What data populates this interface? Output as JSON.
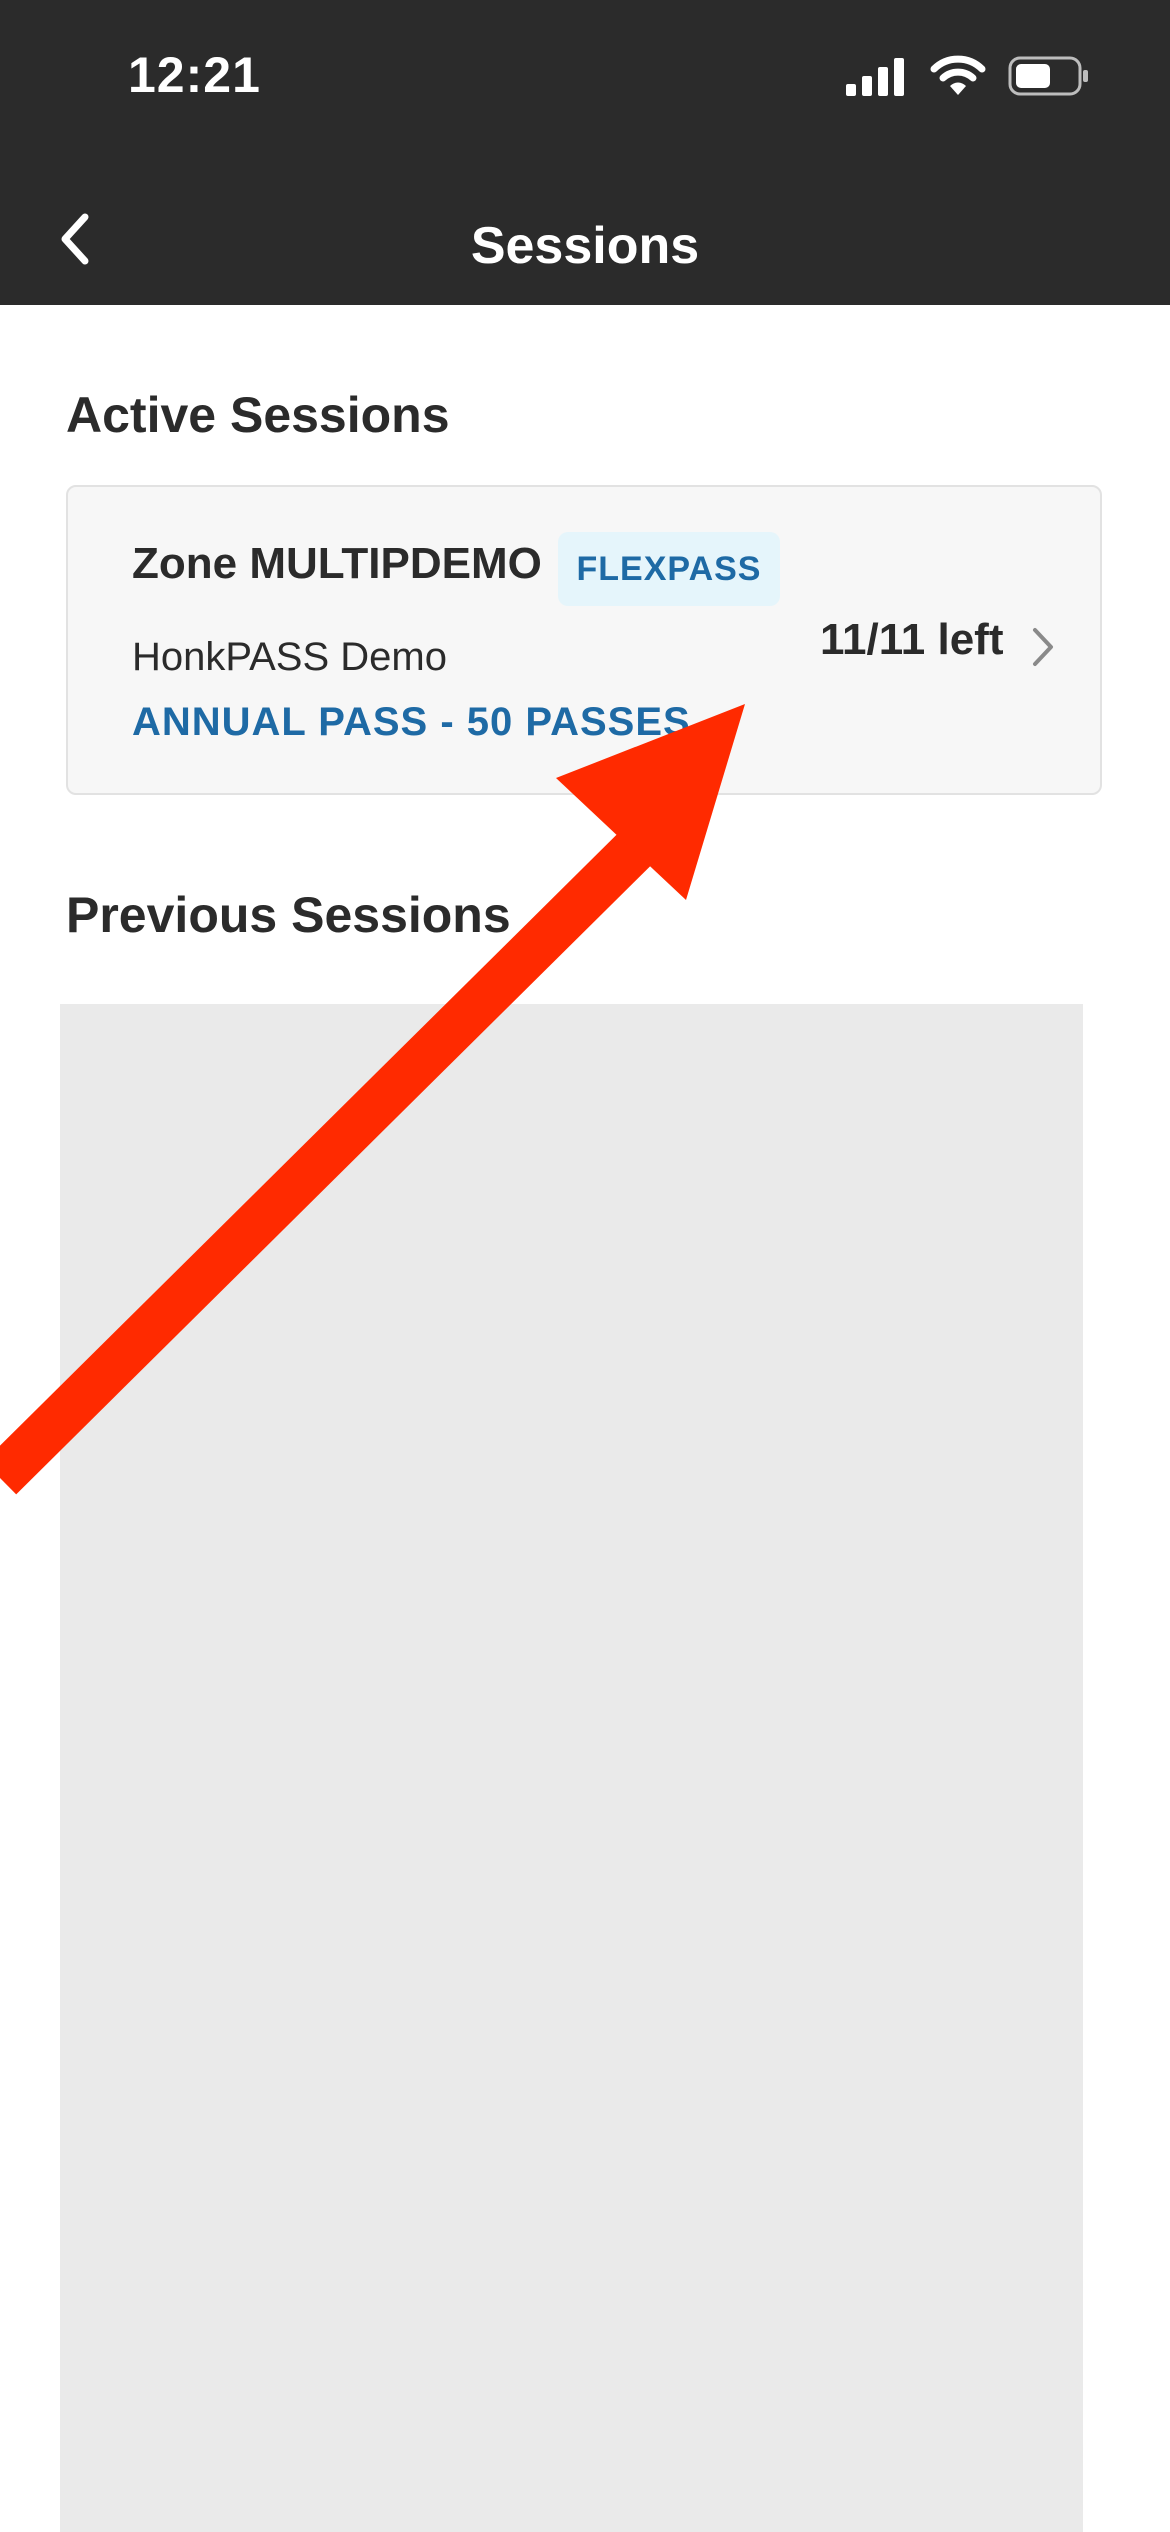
{
  "status_bar": {
    "time": "12:21",
    "icons": [
      "signal-icon",
      "wifi-icon",
      "battery-icon"
    ]
  },
  "nav": {
    "back_icon": "chevron-left-icon",
    "title": "Sessions"
  },
  "active_sessions": {
    "title": "Active Sessions",
    "items": [
      {
        "zone": "Zone MULTIPDEMO",
        "badge": "FLEXPASS",
        "company": "HonkPASS Demo",
        "pass_name": "ANNUAL PASS - 50 PASSES",
        "remaining": "11/11 left",
        "chevron_icon": "chevron-right-icon"
      }
    ]
  },
  "previous_sessions": {
    "title": "Previous Sessions"
  },
  "colors": {
    "header_bg": "#2b2b2b",
    "accent_blue": "#1e6aa5",
    "badge_bg": "#e5f5fb",
    "annotation_arrow": "#ff2a00",
    "placeholder_bg": "#eaeaea"
  }
}
